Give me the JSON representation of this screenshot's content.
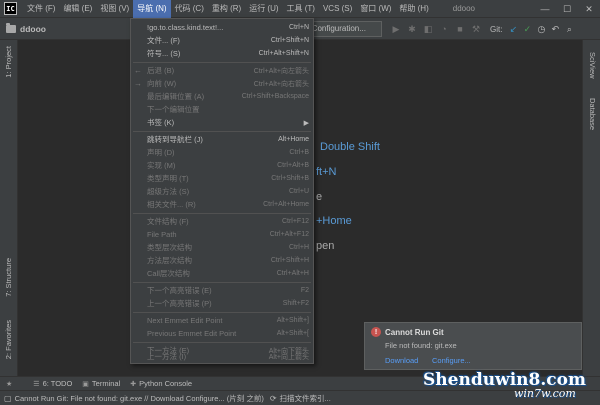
{
  "app": {
    "logo": "IC",
    "window_title": "ddooo"
  },
  "menubar": {
    "items": [
      {
        "label": "文件 (F)"
      },
      {
        "label": "编辑 (E)"
      },
      {
        "label": "视图 (V)"
      },
      {
        "label": "导航 (N)"
      },
      {
        "label": "代码 (C)"
      },
      {
        "label": "重构 (R)"
      },
      {
        "label": "运行 (U)"
      },
      {
        "label": "工具 (T)"
      },
      {
        "label": "VCS (S)"
      },
      {
        "label": "窗口 (W)"
      },
      {
        "label": "帮助 (H)"
      }
    ],
    "active_index": 3
  },
  "window_controls": {
    "minimize": "—",
    "maximize": "☐",
    "close": "✕"
  },
  "navbar": {
    "project_name": "ddooo",
    "run_config": "d Configuration...",
    "git_label": "Git:"
  },
  "sidebar_left": {
    "project_tab": "1: Project",
    "structure_tab": "7: Structure",
    "favorites_tab": "2: Favorites"
  },
  "sidebar_right": {
    "sciview_tab": "SciView",
    "database_tab": "Database"
  },
  "editor_hints": {
    "double_shift": "Double Shift",
    "ft_n": "ft+N",
    "e_fragment": "e",
    "home": "+Home",
    "open": "pen"
  },
  "nav_menu": {
    "items": [
      {
        "label": "!go.to.class.kind.text!...",
        "shortcut": "Ctrl+N",
        "disabled": false
      },
      {
        "label": "文件... (F)",
        "shortcut": "Ctrl+Shift+N",
        "disabled": false
      },
      {
        "label": "符号... (S)",
        "shortcut": "Ctrl+Alt+Shift+N",
        "disabled": false
      },
      {
        "label": "后退 (B)",
        "shortcut": "Ctrl+Alt+向左箭头",
        "disabled": true,
        "icon": "←"
      },
      {
        "label": "向前 (W)",
        "shortcut": "Ctrl+Alt+向右箭头",
        "disabled": true,
        "icon": "→"
      },
      {
        "label": "最后编辑位置 (A)",
        "shortcut": "Ctrl+Shift+Backspace",
        "disabled": true
      },
      {
        "label": "下一个编辑位置",
        "shortcut": "",
        "disabled": true
      },
      {
        "label": "书签 (K)",
        "shortcut": "",
        "disabled": false,
        "submenu": true
      },
      {
        "label": "跳转到导航栏 (J)",
        "shortcut": "Alt+Home",
        "disabled": false
      },
      {
        "label": "声明 (D)",
        "shortcut": "Ctrl+B",
        "disabled": true
      },
      {
        "label": "实现 (M)",
        "shortcut": "Ctrl+Alt+B",
        "disabled": true
      },
      {
        "label": "类型声明 (T)",
        "shortcut": "Ctrl+Shift+B",
        "disabled": true
      },
      {
        "label": "超级方法 (S)",
        "shortcut": "Ctrl+U",
        "disabled": true
      },
      {
        "label": "相关文件... (R)",
        "shortcut": "Ctrl+Alt+Home",
        "disabled": true
      },
      {
        "label": "文件结构 (F)",
        "shortcut": "Ctrl+F12",
        "disabled": true
      },
      {
        "label": "File Path",
        "shortcut": "Ctrl+Alt+F12",
        "disabled": true
      },
      {
        "label": "类型层次结构",
        "shortcut": "Ctrl+H",
        "disabled": true
      },
      {
        "label": "方法层次结构",
        "shortcut": "Ctrl+Shift+H",
        "disabled": true
      },
      {
        "label": "Call层次结构",
        "shortcut": "Ctrl+Alt+H",
        "disabled": true
      },
      {
        "label": "下一个高亮错误 (E)",
        "shortcut": "F2",
        "disabled": true
      },
      {
        "label": "上一个高亮错误 (P)",
        "shortcut": "Shift+F2",
        "disabled": true
      },
      {
        "label": "Next Emmet Edit Point",
        "shortcut": "Alt+Shift+]",
        "disabled": true
      },
      {
        "label": "Previous Emmet Edit Point",
        "shortcut": "Alt+Shift+[",
        "disabled": true
      },
      {
        "label": "下一方法 (E)",
        "shortcut": "Alt+向下箭头",
        "disabled": true
      },
      {
        "label": "上一方法 (I)",
        "shortcut": "Alt+向上箭头",
        "disabled": true
      }
    ]
  },
  "bottom_tabs": [
    {
      "label": "6: TODO",
      "icon": "☰"
    },
    {
      "label": "Terminal",
      "icon": "▣"
    },
    {
      "label": "Python Console",
      "icon": "✚"
    }
  ],
  "status": {
    "message": "Cannot Run Git: File not found: git.exe // Download   Configure... (片刻 之前)",
    "indexing": "扫描文件索引..."
  },
  "notification": {
    "title": "Cannot Run Git",
    "message": "File not found: git.exe",
    "download": "Download",
    "configure": "Configure..."
  },
  "watermark": {
    "brand": "Shenduwin8.com",
    "sub": "win7w.com"
  },
  "colors": {
    "accent": "#4b6eaf",
    "link": "#589df6",
    "error": "#c75450",
    "git_update": "#3592c4",
    "git_commit": "#499c54"
  }
}
